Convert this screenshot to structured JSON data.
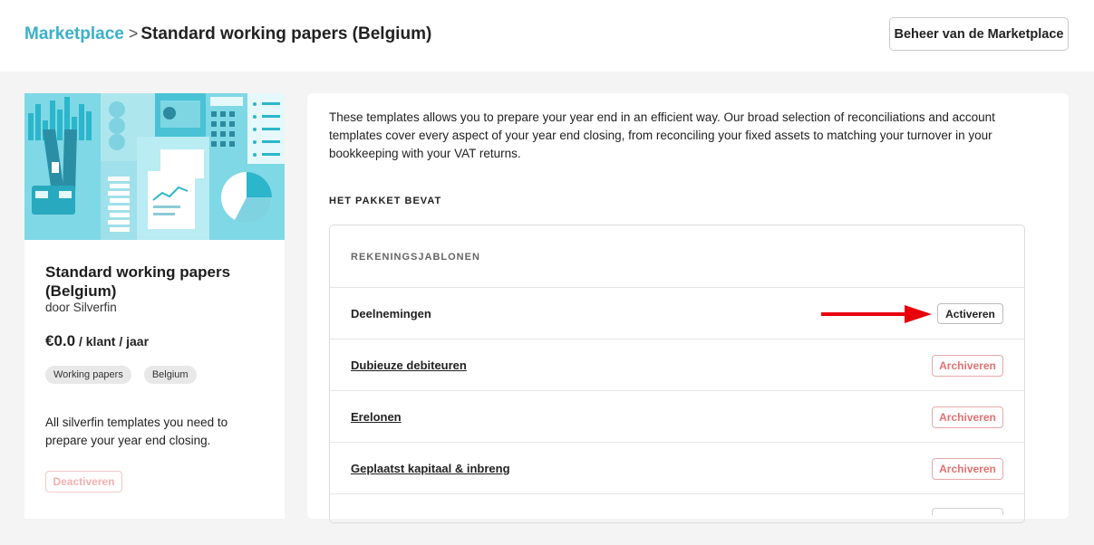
{
  "breadcrumb": {
    "parent": "Marketplace",
    "separator": ">",
    "current": "Standard working papers (Belgium)"
  },
  "header": {
    "manage_button": "Beheer van de Marketplace"
  },
  "sidebar": {
    "title": "Standard working papers (Belgium)",
    "author": "door Silverfin",
    "price": "€0.0",
    "price_unit": " / klant / jaar",
    "tags": [
      "Working papers",
      "Belgium"
    ],
    "description": "All silverfin templates you need to prepare your year end closing.",
    "deactivate_button": "Deactiveren"
  },
  "main": {
    "intro": "These templates allows you to prepare your year end in an efficient way. Our broad selection of reconciliations and account templates cover every aspect of your year end closing, from reconciling your fixed assets to matching your turnover in your bookkeeping with your VAT returns.",
    "package_heading": "HET PAKKET BEVAT",
    "section_label": "REKENINGSJABLONEN",
    "items": [
      {
        "name": "Deelnemingen",
        "action": "Activeren"
      },
      {
        "name": "Dubieuze debiteuren",
        "action": "Archiveren"
      },
      {
        "name": "Erelonen",
        "action": "Archiveren"
      },
      {
        "name": "Geplaatst kapitaal & inbreng",
        "action": "Archiveren"
      }
    ]
  },
  "colors": {
    "link": "#3bb0c9",
    "archive": "#e27171",
    "annotation_arrow": "#e8000b",
    "banner": "#cdeff4"
  },
  "icons": [
    "annotation-arrow-icon",
    "marketplace-banner-illustration"
  ]
}
